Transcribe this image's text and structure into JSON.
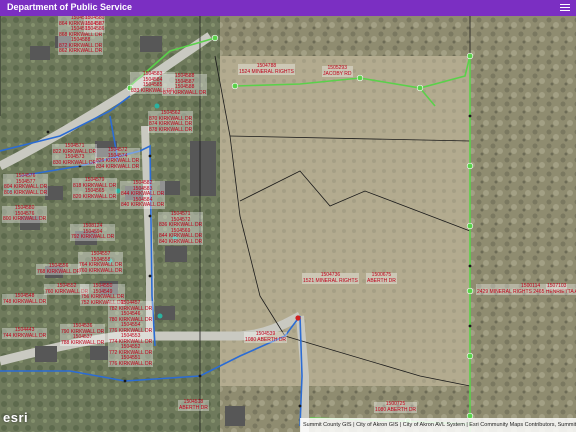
{
  "app": {
    "title": "Department of Public Service",
    "menu_icon": "hamburger-menu-icon"
  },
  "attribution": "Summit County GIS | City of Akron GIS | City of Akron AVL System | Esri Community Maps Contributors, Summit C",
  "logo_text": "esri",
  "street_labels": [
    "Kirkwall Dr",
    "ABERTH DR"
  ],
  "parcels": [
    {
      "id": "p1",
      "text": "1504580\n864 KIRKWALL DR\n1504589\n868 KIRKWALL DR\n1504588\n872 KIRKWALL DR\n862 KIRKWALL DR"
    },
    {
      "id": "p2",
      "text": "1504580\n1504587\n1504586"
    },
    {
      "id": "p3",
      "text": "1504788\n1524 MINERAL RIGHTS"
    },
    {
      "id": "p4",
      "text": "1505293\nJACOBY RD"
    },
    {
      "id": "p5",
      "text": "1504583\n1504584\n1504585\n833 KIRKWALL DR"
    },
    {
      "id": "p6",
      "text": "1504588\n1504587\n1504588\n870 KIRKWALL DR"
    },
    {
      "id": "p7",
      "text": "1504562\n870 KIRKWALL DR\n874 KIRKWALL DR\n878 KIRKWALL DR"
    },
    {
      "id": "p8",
      "text": "1504571\n822 KIRKWALL DR\n1504573\n830 KIRKWALL DR"
    },
    {
      "id": "p9",
      "text": "1504572\n1504574\n826 KIRKWALL DR\n834 KIRKWALL DR"
    },
    {
      "id": "p10",
      "text": "1504576\n1504577\n804 KIRKWALL DR\n808 KIRKWALL DR"
    },
    {
      "id": "p11",
      "text": "1504579\n818 KIRKWALL DR\n1504565\n820 KIRKWALL DR"
    },
    {
      "id": "p12",
      "text": "1504582\n1504583\n844 KIRKWALL DR\n1504584\n840 KIRKWALL DR"
    },
    {
      "id": "p13",
      "text": "1504580\n1504576\n800 KIRKWALL DR"
    },
    {
      "id": "p14",
      "text": "1508124\n1504594\n792 KIRKWALL DR"
    },
    {
      "id": "p15",
      "text": "1504571\n1504572\n836 KIRKWALL DR\n1504569\n844 KIRKWALL DR\n840 KIRKWALL DR"
    },
    {
      "id": "p16",
      "text": "1504556\n768 KIRKWALL DR"
    },
    {
      "id": "p17",
      "text": "1504557\n1504558\n764 KIRKWALL DR\n760 KIRKWALL DR"
    },
    {
      "id": "p18",
      "text": "1504552\n760 KIRKWALL DR"
    },
    {
      "id": "p19",
      "text": "1504550\n1504549\n756 KIRKWALL DR\n752 KIRKWALL DR"
    },
    {
      "id": "p20",
      "text": "1504548\n748 KIRKWALL DR"
    },
    {
      "id": "p21",
      "text": "1504736\n1521 MINERAL RIGHTS"
    },
    {
      "id": "p22",
      "text": "1500675\nABERTH DR"
    },
    {
      "id": "p23",
      "text": "1500114\n2429 MINERAL RIGHTS 2465 HENRIETTA AVE"
    },
    {
      "id": "p24",
      "text": "1507103"
    },
    {
      "id": "p25",
      "text": "1504539\n1080 ABERTH DR"
    },
    {
      "id": "p26",
      "text": "1504457\n782 KIRKWALL DR\n1504546\n780 KIRKWALL DR\n1504554\n776 KIRKWALL DR\n1504553\n774 KIRKWALL DR\n1504552\n772 KIRKWALL DR\n1504551\n776 KIRKWALL DR"
    },
    {
      "id": "p27",
      "text": "1504536\n790 KIRKWALL DR\n1504537\n788 KIRKWALL DR"
    },
    {
      "id": "p28",
      "text": "1504443\n744 KIRKWALL DR"
    },
    {
      "id": "p29",
      "text": "1500725\n1080 ABERTH DR"
    },
    {
      "id": "p30",
      "text": "1504518\nABERTH DR"
    }
  ]
}
